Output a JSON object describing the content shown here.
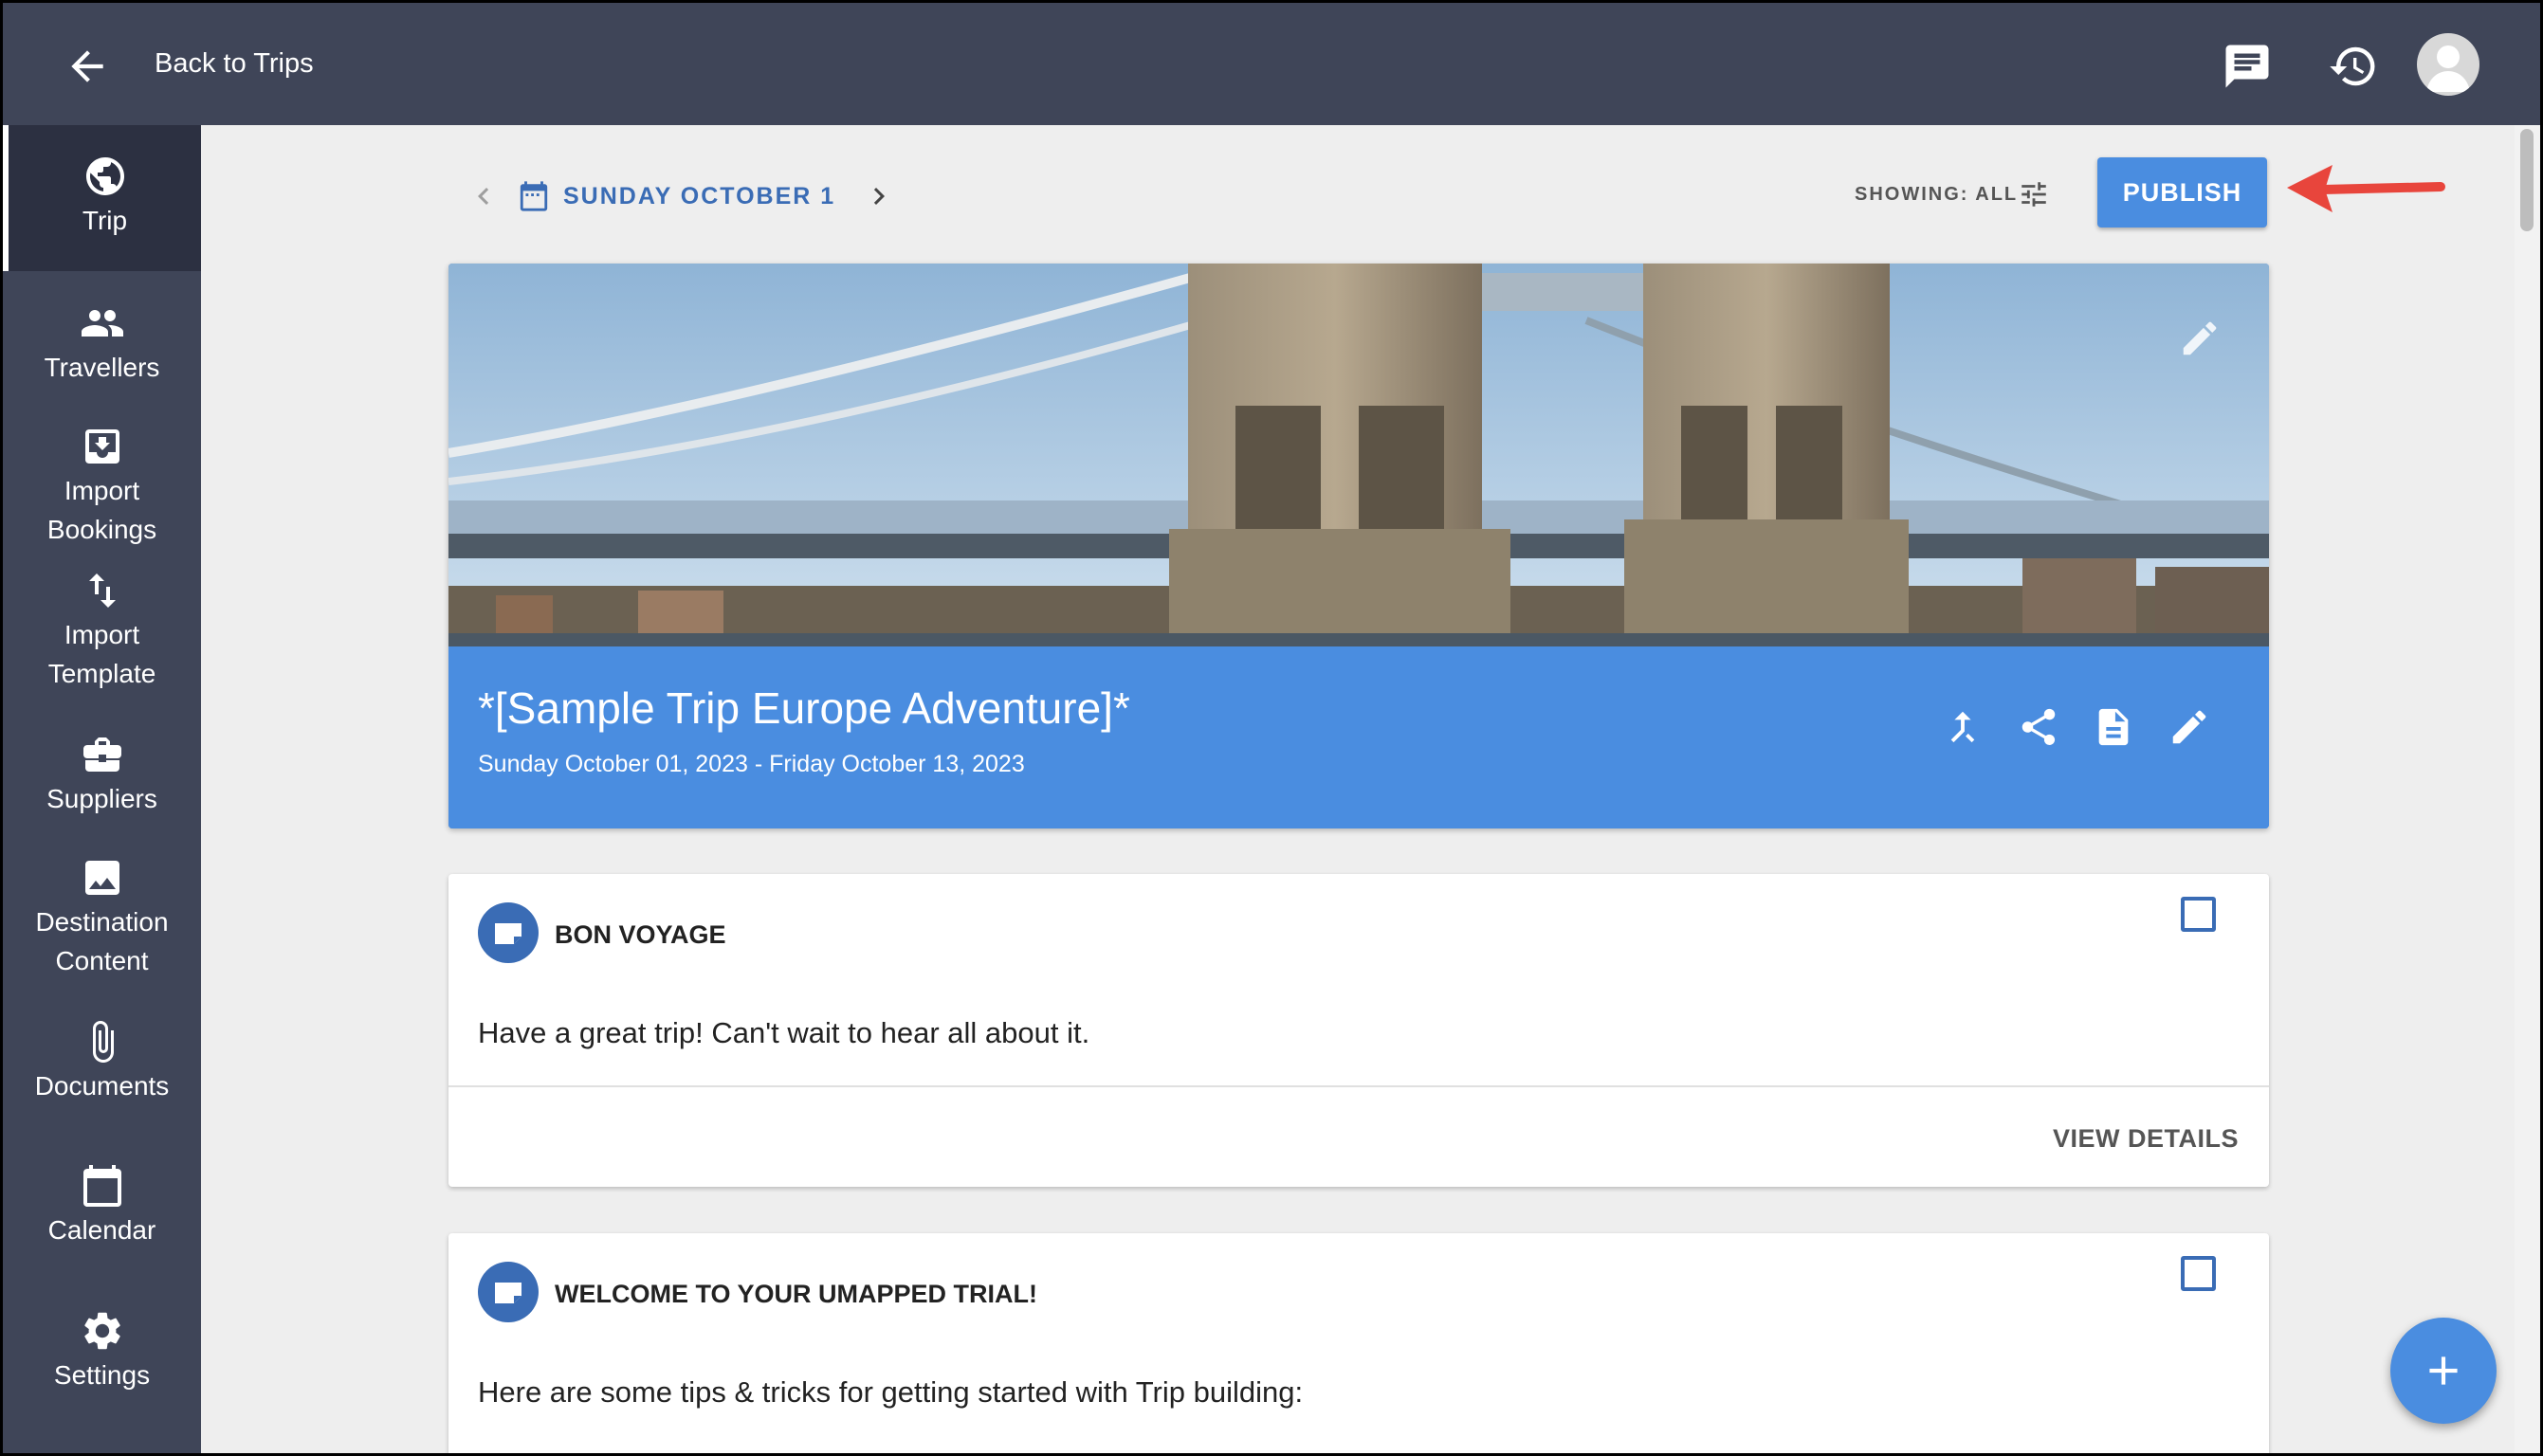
{
  "topbar": {
    "back_label": "Back to Trips"
  },
  "sidebar": {
    "items": [
      {
        "label": "Trip",
        "icon": "globe-icon"
      },
      {
        "label": "Travellers",
        "icon": "people-icon"
      },
      {
        "label": "Import Bookings",
        "icon": "import-icon"
      },
      {
        "label": "Import Template",
        "icon": "swap-vert-icon"
      },
      {
        "label": "Suppliers",
        "icon": "briefcase-icon"
      },
      {
        "label": "Destination Content",
        "icon": "image-icon"
      },
      {
        "label": "Documents",
        "icon": "paperclip-icon"
      },
      {
        "label": "Calendar",
        "icon": "calendar-icon"
      },
      {
        "label": "Settings",
        "icon": "gear-icon"
      }
    ]
  },
  "toolbar": {
    "date_label": "SUNDAY OCTOBER 1",
    "showing_label": "SHOWING: ALL",
    "publish_label": "PUBLISH"
  },
  "hero": {
    "title": "*[Sample Trip Europe Adventure]*",
    "dates": "Sunday October 01, 2023 - Friday October 13, 2023"
  },
  "cards": [
    {
      "title": "BON VOYAGE",
      "body": "Have a great trip!  Can't wait to hear all about it.",
      "action": "VIEW DETAILS"
    },
    {
      "title": "WELCOME TO YOUR UMAPPED TRIAL!",
      "body": "Here are some tips & tricks for getting started with Trip building:"
    }
  ],
  "colors": {
    "nav_bg": "#3f4558",
    "accent_blue": "#4a8de0",
    "dark_blue": "#3a6cb5",
    "annotation_red": "#e8453c"
  }
}
